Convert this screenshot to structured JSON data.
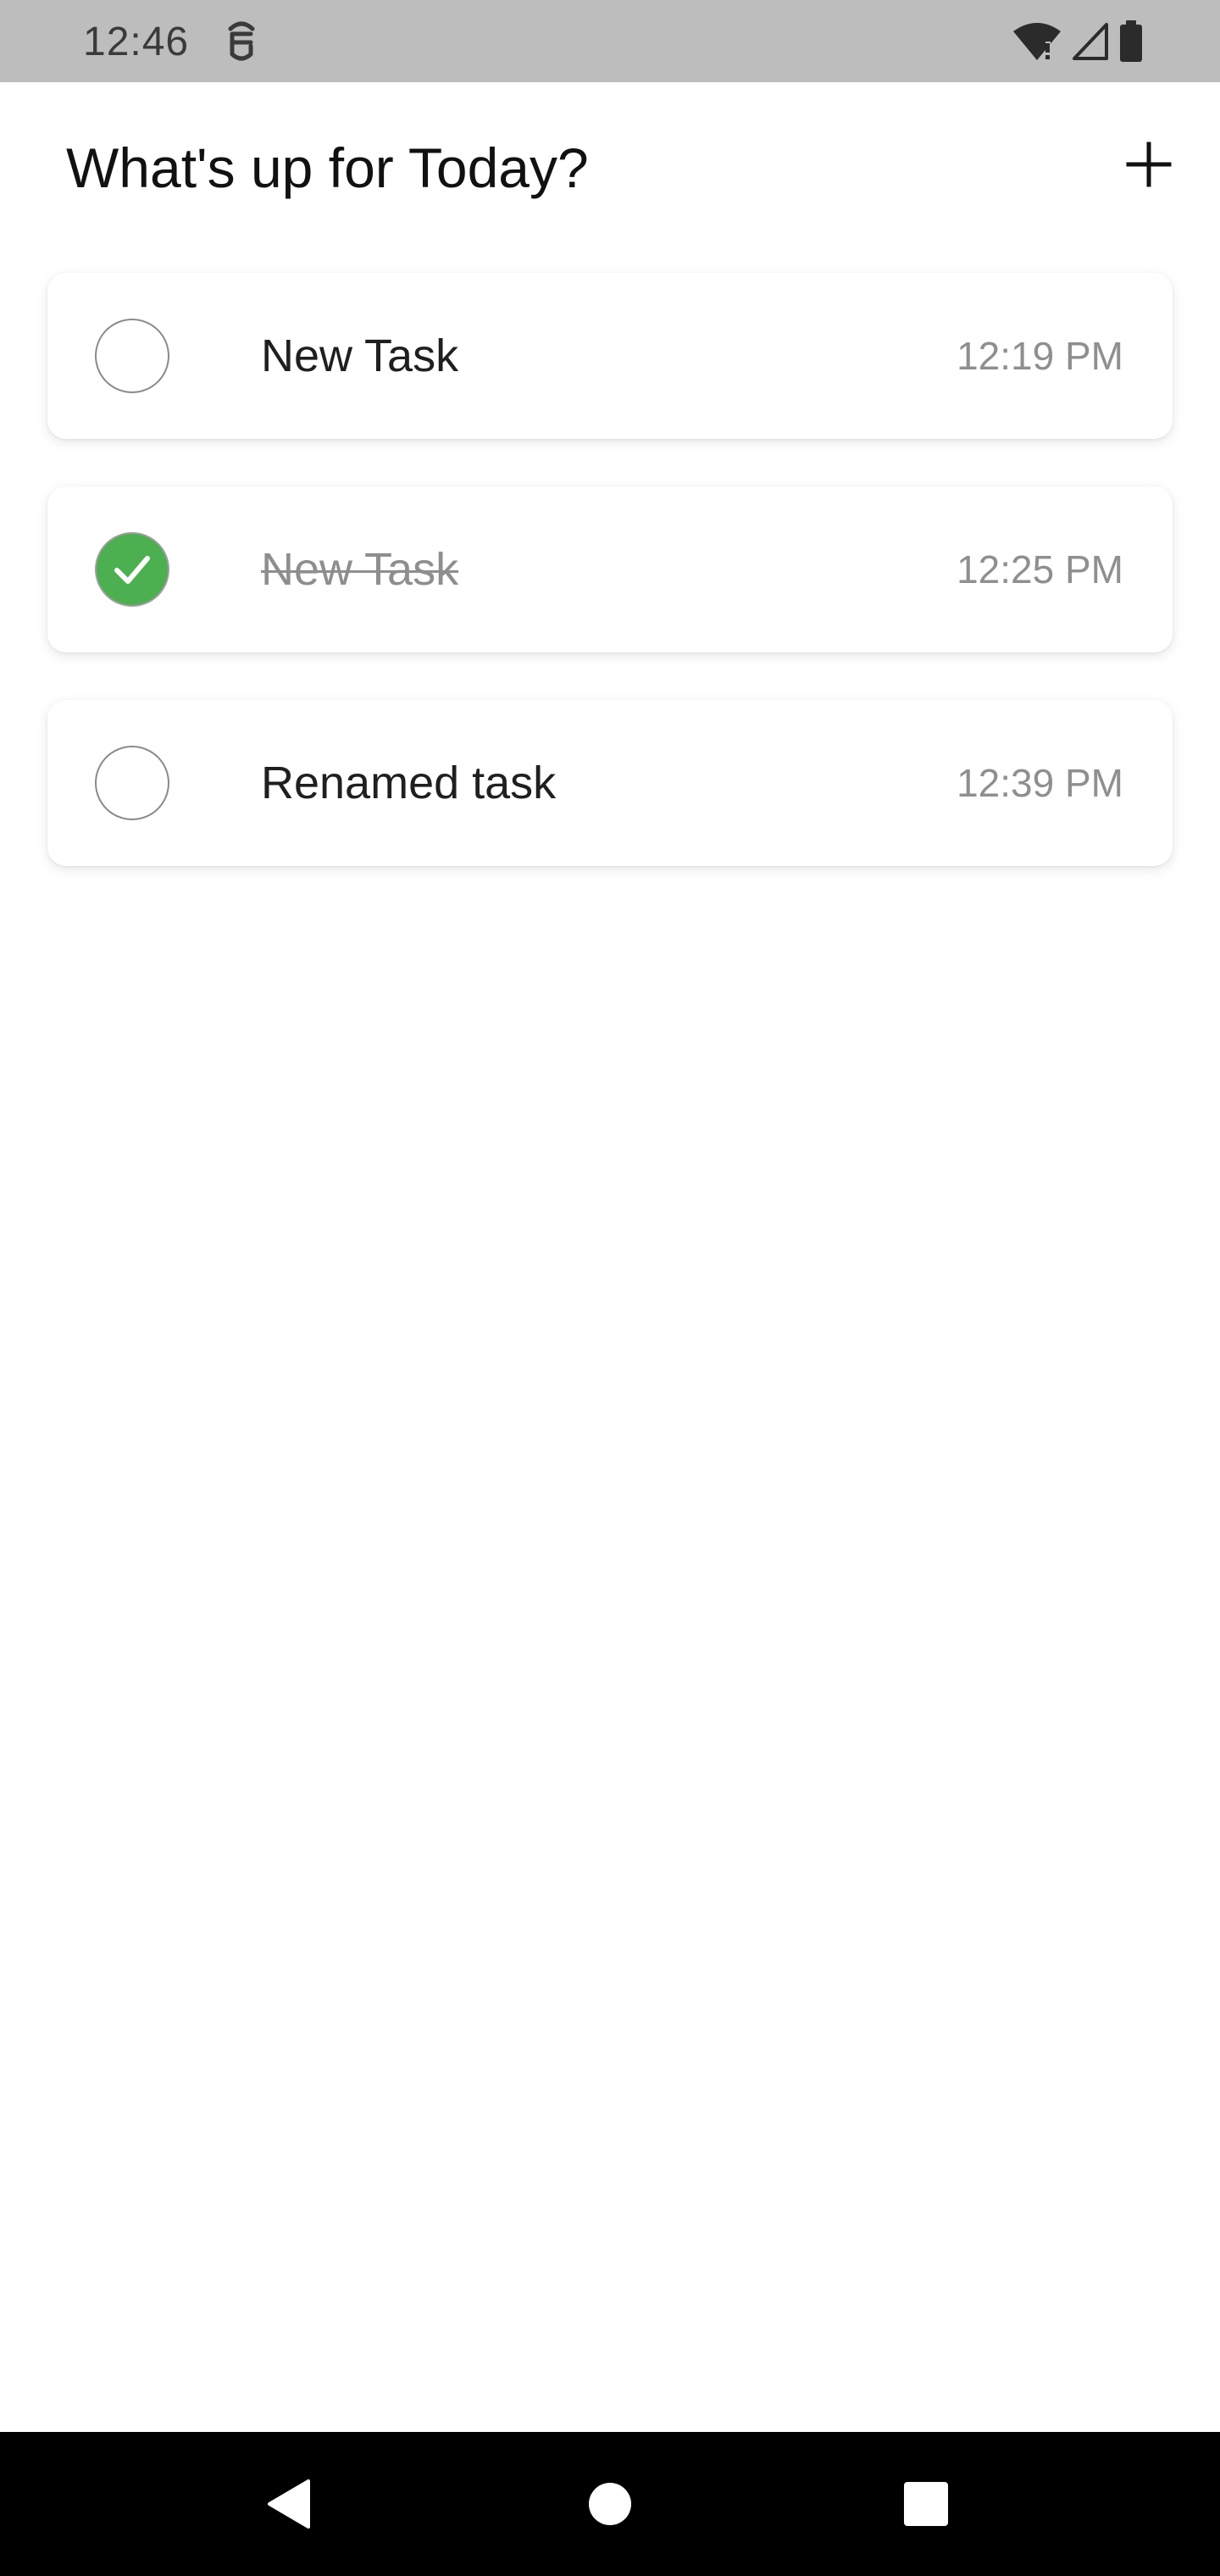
{
  "status_bar": {
    "time": "12:46",
    "notification_icon": "notification-icon",
    "icons": [
      "wifi-alert-icon",
      "cell-signal-icon",
      "battery-icon"
    ],
    "background": "#bdbdbd"
  },
  "header": {
    "title": "What's up for Today?",
    "add_icon": "plus-icon"
  },
  "tasks": [
    {
      "title": "New Task",
      "time": "12:19 PM",
      "completed": false
    },
    {
      "title": "New Task",
      "time": "12:25 PM",
      "completed": true
    },
    {
      "title": "Renamed task",
      "time": "12:39 PM",
      "completed": false
    }
  ],
  "colors": {
    "check_done": "#4caf50",
    "time_text": "#8f8f8f",
    "done_text": "#8e8e8e"
  },
  "nav_bar": {
    "icons": [
      "back-icon",
      "home-icon",
      "recents-icon"
    ]
  }
}
